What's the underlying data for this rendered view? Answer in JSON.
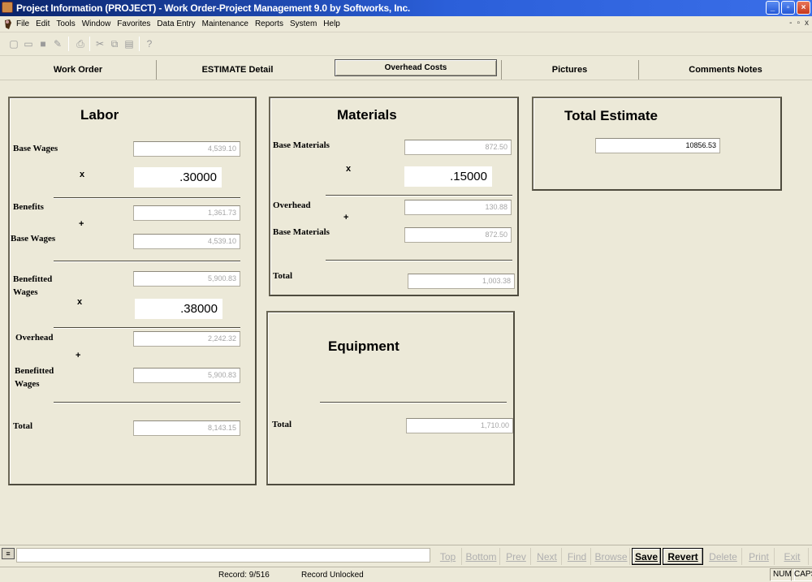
{
  "window": {
    "title": "Project Information  (PROJECT) - Work Order-Project Management 9.0 by Softworks, Inc."
  },
  "menu": [
    "File",
    "Edit",
    "Tools",
    "Window",
    "Favorites",
    "Data Entry",
    "Maintenance",
    "Reports",
    "System",
    "Help"
  ],
  "mdi_controls": [
    "-",
    "▫",
    "x"
  ],
  "toolbar": {
    "icons": [
      "new-icon",
      "open-icon",
      "save-icon",
      "edit-icon",
      "print-icon",
      "cut-icon",
      "copy-icon",
      "paste-icon",
      "help-icon"
    ]
  },
  "tabs": [
    {
      "label": "Work Order"
    },
    {
      "label": "ESTIMATE Detail"
    },
    {
      "label": "Overhead Costs"
    },
    {
      "label": "Pictures"
    },
    {
      "label": "Comments Notes"
    }
  ],
  "labor": {
    "title": "Labor",
    "base_wages_label": "Base Wages",
    "base_wages": "4,539.10",
    "times": "x",
    "rate1": ".30000",
    "benefits_label": "Benefits",
    "benefits": "1,361.73",
    "plus": "+",
    "base_wages2_label": "Base Wages",
    "base_wages2": "4,539.10",
    "benefitted_wages_label": "Benefitted Wages",
    "benefitted_wages": "5,900.83",
    "rate2": ".38000",
    "overhead_label": "Overhead",
    "overhead": "2,242.32",
    "benefitted_wages2_label": "Benefitted Wages",
    "benefitted_wages2": "5,900.83",
    "total_label": "Total",
    "total": "8,143.15"
  },
  "materials": {
    "title": "Materials",
    "base_materials_label": "Base Materials",
    "base_materials": "872.50",
    "times": "x",
    "rate": ".15000",
    "overhead_label": "Overhead",
    "overhead": "130.88",
    "plus": "+",
    "base_materials2_label": "Base Materials",
    "base_materials2": "872.50",
    "total_label": "Total",
    "total": "1,003.38"
  },
  "equipment": {
    "title": "Equipment",
    "total_label": "Total",
    "total": "1,710.00"
  },
  "total_estimate": {
    "title": "Total Estimate",
    "value": "10856.53"
  },
  "navigation": {
    "buttons": [
      {
        "label": "Top",
        "enabled": false
      },
      {
        "label": "Bottom",
        "enabled": false
      },
      {
        "label": "Prev",
        "enabled": false
      },
      {
        "label": "Next",
        "enabled": false
      },
      {
        "label": "Find",
        "enabled": false
      },
      {
        "label": "Browse",
        "enabled": false
      },
      {
        "label": "Save",
        "enabled": true
      },
      {
        "label": "Revert",
        "enabled": true
      },
      {
        "label": "Delete",
        "enabled": false
      },
      {
        "label": "Print",
        "enabled": false
      },
      {
        "label": "Exit",
        "enabled": false
      }
    ]
  },
  "status": {
    "record": "Record: 9/516",
    "lock": "Record Unlocked",
    "num": "NUM",
    "caps": "CAPS"
  }
}
